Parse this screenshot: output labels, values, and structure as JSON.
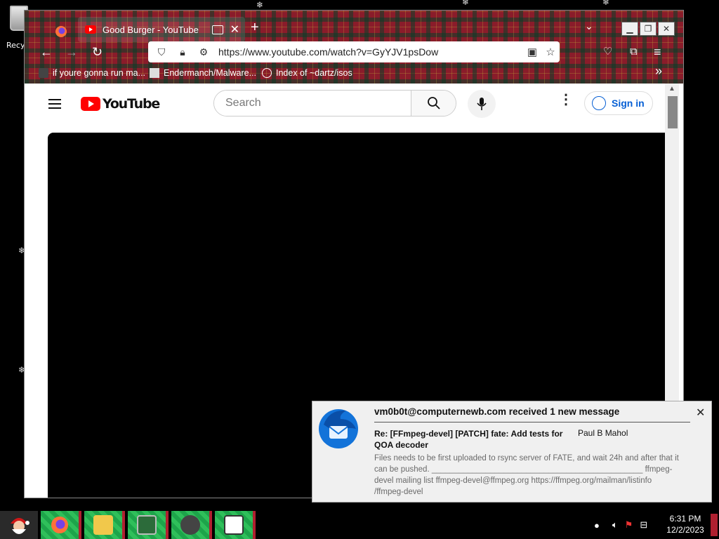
{
  "desktop": {
    "recycle_label": "Recy",
    "snowflake": "❄"
  },
  "browser": {
    "tab_title": "Good Burger - YouTube",
    "new_tab": "+",
    "tab_close": "✕",
    "url": "https://www.youtube.com/watch?v=GyYJV1psDow",
    "bookmarks": [
      {
        "label": "if youre gonna run ma..."
      },
      {
        "label": "Endermanch/Malware..."
      },
      {
        "label": "Index of ~dartz/isos"
      }
    ],
    "bookmarks_overflow": "»"
  },
  "youtube": {
    "logo_text": "YouTube",
    "search_placeholder": "Search",
    "more_label": "⋮",
    "signin_label": "Sign in"
  },
  "notification": {
    "account": "vm0b0t@computernewb.com received 1 new message",
    "subject": "Re: [FFmpeg-devel] [PATCH] fate: Add tests for QOA decoder",
    "from": "Paul B Mahol",
    "body": "Files needs to be first uploaded to rsync server of FATE, and wait 24h and after that it can be pushed. _______________________________________________ ffmpeg-devel mailing list ffmpeg-devel@ffmpeg.org https://ffmpeg.org/mailman/listinfo /ffmpeg-devel",
    "close": "✕"
  },
  "taskbar": {
    "time": "6:31 PM",
    "date": "12/2/2023"
  },
  "colors": {
    "youtube_red": "#ff0000",
    "link_blue": "#065fd4",
    "taskbar_green": "#2fbf5a"
  }
}
